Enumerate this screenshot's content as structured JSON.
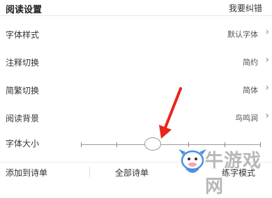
{
  "header": {
    "title": "阅读设置",
    "action": "我要纠错"
  },
  "settings": [
    {
      "label": "字体样式",
      "value": "默认字体"
    },
    {
      "label": "注释切换",
      "value": "简约"
    },
    {
      "label": "简繁切换",
      "value": "简体"
    },
    {
      "label": "阅读背景",
      "value": "鸟鸣涧"
    }
  ],
  "font_size": {
    "label": "字体大小",
    "level_fraction": 0.4
  },
  "footer": {
    "items": [
      "添加到诗单",
      "全部诗单",
      "练字模式"
    ]
  },
  "watermark": {
    "text": "牛游戏网"
  },
  "colors": {
    "arrow": "#e8261c",
    "watermark": "#b7b7b7",
    "mascot": "#4a90e2"
  },
  "icons": [
    "chevron-right-icon",
    "red-arrow-icon",
    "mascot-logo-icon"
  ]
}
